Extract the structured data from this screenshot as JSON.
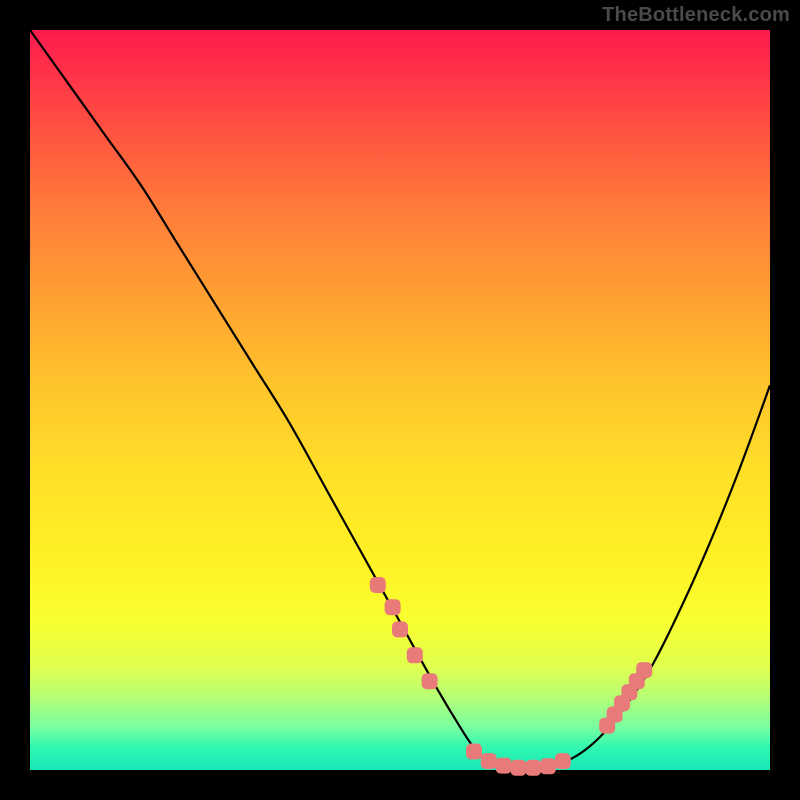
{
  "watermark": "TheBottleneck.com",
  "chart_data": {
    "type": "line",
    "title": "",
    "xlabel": "",
    "ylabel": "",
    "xlim": [
      0,
      100
    ],
    "ylim": [
      0,
      100
    ],
    "series": [
      {
        "name": "bottleneck-curve",
        "x": [
          0,
          5,
          10,
          15,
          20,
          25,
          30,
          35,
          40,
          45,
          50,
          55,
          58,
          60,
          62,
          65,
          68,
          72,
          76,
          80,
          84,
          88,
          92,
          96,
          100
        ],
        "values": [
          100,
          93,
          86,
          79,
          71,
          63,
          55,
          47,
          38,
          29,
          20,
          11,
          6,
          3,
          1,
          0.3,
          0.3,
          1,
          3.5,
          8,
          14,
          22,
          31,
          41,
          52
        ]
      }
    ],
    "markers": {
      "name": "highlighted-points",
      "color": "#e97a7a",
      "points": [
        {
          "x": 47,
          "y": 25
        },
        {
          "x": 49,
          "y": 22
        },
        {
          "x": 50,
          "y": 19
        },
        {
          "x": 52,
          "y": 15.5
        },
        {
          "x": 54,
          "y": 12
        },
        {
          "x": 60,
          "y": 2.5
        },
        {
          "x": 62,
          "y": 1.2
        },
        {
          "x": 64,
          "y": 0.6
        },
        {
          "x": 66,
          "y": 0.3
        },
        {
          "x": 68,
          "y": 0.3
        },
        {
          "x": 70,
          "y": 0.5
        },
        {
          "x": 72,
          "y": 1.2
        },
        {
          "x": 78,
          "y": 6
        },
        {
          "x": 79,
          "y": 7.5
        },
        {
          "x": 80,
          "y": 9
        },
        {
          "x": 81,
          "y": 10.5
        },
        {
          "x": 82,
          "y": 12
        },
        {
          "x": 83,
          "y": 13.5
        }
      ]
    }
  }
}
